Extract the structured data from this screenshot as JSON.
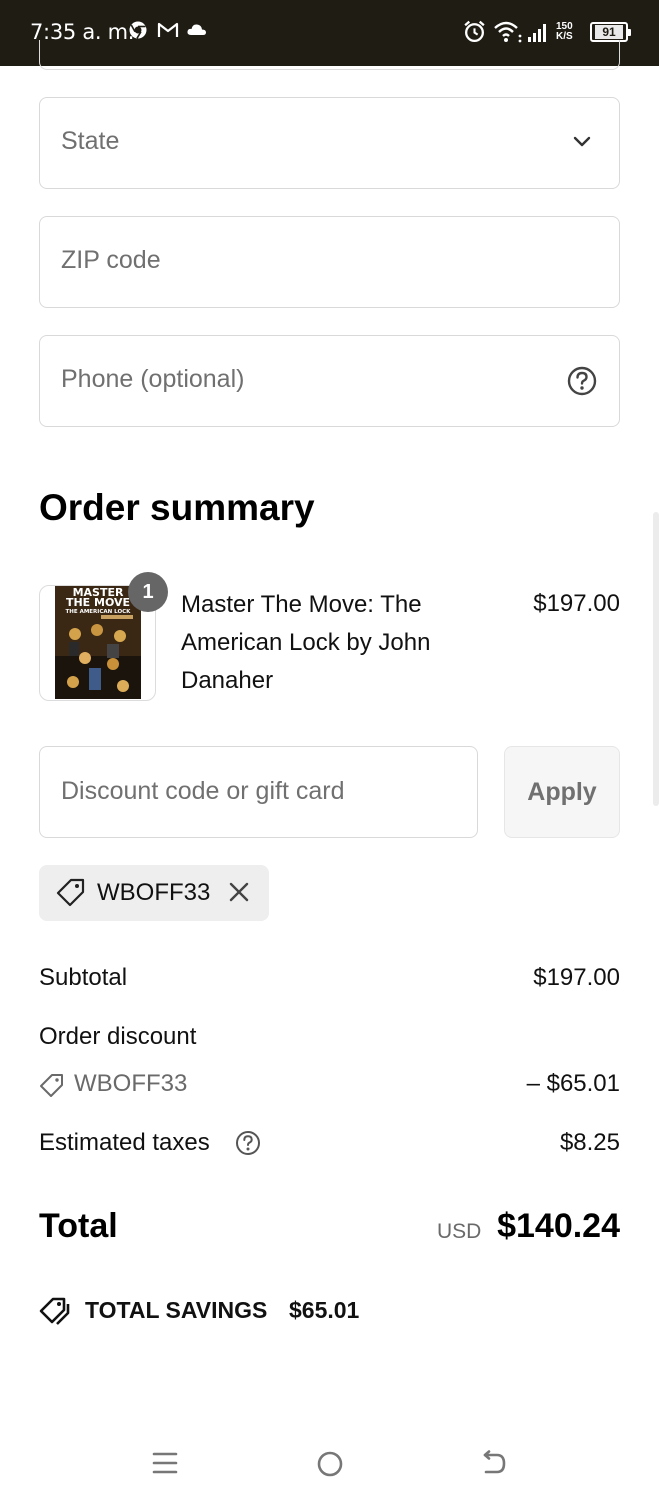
{
  "status_bar": {
    "time": "7:35 a. m.",
    "net_speed_value": "150",
    "net_speed_unit": "K/S",
    "battery": "91"
  },
  "form": {
    "state_placeholder": "State",
    "zip_placeholder": "ZIP code",
    "phone_placeholder": "Phone (optional)"
  },
  "order_summary": {
    "heading": "Order summary",
    "product": {
      "quantity": "1",
      "name": "Master The Move: The American Lock by John Danaher",
      "price": "$197.00",
      "cover_title_line1": "MASTER",
      "cover_title_line2": "THE MOVE",
      "cover_subtitle": "THE AMERICAN LOCK"
    },
    "discount_placeholder": "Discount code or gift card",
    "apply_label": "Apply",
    "applied_code": "WBOFF33"
  },
  "totals": {
    "subtotal_label": "Subtotal",
    "subtotal_value": "$197.00",
    "discount_label": "Order discount",
    "discount_code": "WBOFF33",
    "discount_value": "– $65.01",
    "taxes_label": "Estimated taxes",
    "taxes_value": "$8.25",
    "total_label": "Total",
    "currency": "USD",
    "total_value": "$140.24",
    "savings_label": "TOTAL SAVINGS",
    "savings_value": "$65.01"
  },
  "colors": {
    "status_bar_bg": "#1f1c14",
    "border": "#d9d9d9",
    "muted_text": "#707070",
    "chip_bg": "#eeeeee"
  }
}
